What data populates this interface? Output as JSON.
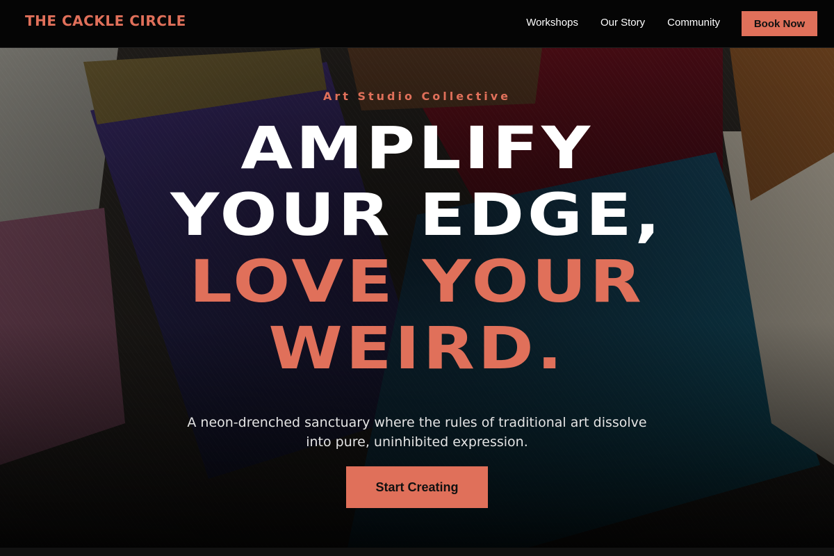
{
  "colors": {
    "accent": "#e0705a",
    "nav_background": "#050505",
    "headline_white": "#ffffff"
  },
  "nav": {
    "brand": "THE CACKLE CIRCLE",
    "links": [
      "Workshops",
      "Our Story",
      "Community"
    ],
    "cta_label": "Book Now"
  },
  "hero": {
    "background_image": "paint-brushes-photo",
    "kicker": "Art Studio Collective",
    "headline_lines": [
      "AMPLIFY",
      "YOUR EDGE,",
      "LOVE YOUR",
      "WEIRD."
    ],
    "subtext": "A neon-drenched sanctuary where the rules of traditional art dissolve into pure, uninhibited expression.",
    "cta_label": "Start Creating"
  }
}
